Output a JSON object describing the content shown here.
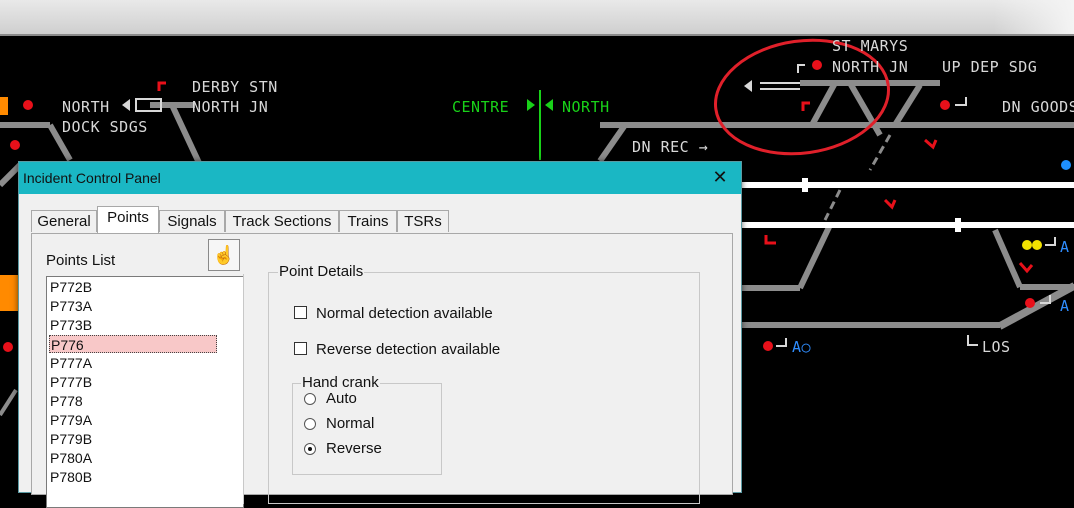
{
  "diagram": {
    "labels": {
      "st_marys": "ST MARYS",
      "north_jn_top": "NORTH JN",
      "up_dep_sdg": "UP DEP SDG",
      "derby_stn": "DERBY STN",
      "north_jn_left": "NORTH JN",
      "north": "NORTH",
      "dock_sdgs": "DOCK SDGS",
      "centre": "CENTRE",
      "north_green": "NORTH",
      "dn_goods": "DN GOODS",
      "dn_rec": "DN REC →",
      "ac_right1": "A",
      "ac_right2": "A",
      "ac_bottom": "A○",
      "los": "LOS"
    },
    "colors": {
      "track": "#8c8c8c",
      "occupied_track": "#ffffff",
      "signal_red": "#e8101a",
      "signal_yellow": "#f2e200",
      "signal_blue": "#1e90ff",
      "green_text": "#19d219",
      "annotation_circle": "#e0202a"
    }
  },
  "dialog": {
    "title": "Incident Control Panel",
    "close_icon": "close-icon",
    "tabs": [
      {
        "label": "General"
      },
      {
        "label": "Points"
      },
      {
        "label": "Signals"
      },
      {
        "label": "Track Sections"
      },
      {
        "label": "Trains"
      },
      {
        "label": "TSRs"
      }
    ],
    "active_tab": "Points",
    "points_list_label": "Points List",
    "pick_icon": "pointer-hand-icon",
    "points": [
      "P772B",
      "P773A",
      "P773B",
      "P776",
      "P777A",
      "P777B",
      "P778",
      "P779A",
      "P779B",
      "P780A",
      "P780B"
    ],
    "selected_point": "P776",
    "point_details": {
      "title": "Point Details",
      "normal_detection": "Normal detection available",
      "reverse_detection": "Reverse detection available",
      "hand_crank": {
        "title": "Hand crank",
        "options": [
          "Auto",
          "Normal",
          "Reverse"
        ],
        "selected": "Reverse"
      }
    }
  }
}
